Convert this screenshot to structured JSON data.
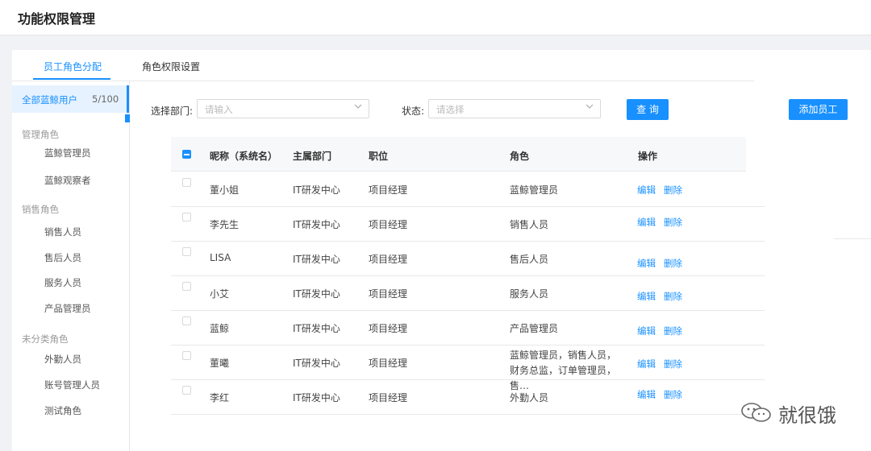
{
  "page": {
    "title": "功能权限管理"
  },
  "tabs": [
    {
      "label": "员工角色分配",
      "active": true
    },
    {
      "label": "角色权限设置",
      "active": false
    }
  ],
  "sidebar": {
    "all_users_label": "全部蓝鲸用户",
    "all_users_count": "5/100",
    "groups": [
      {
        "title": "管理角色",
        "items": [
          "蓝鲸管理员",
          "蓝鲸观察者"
        ]
      },
      {
        "title": "销售角色",
        "items": [
          "销售人员",
          "售后人员",
          "服务人员",
          "产品管理员"
        ]
      },
      {
        "title": "未分类角色",
        "items": [
          "外勤人员",
          "账号管理人员",
          "测试角色"
        ]
      }
    ]
  },
  "filters": {
    "dept_label": "选择部门:",
    "dept_placeholder": "请输入",
    "status_label": "状态:",
    "status_placeholder": "请选择",
    "query_button": "查 询",
    "add_button": "添加员工"
  },
  "table": {
    "columns": [
      "昵称（系统名）",
      "主属部门",
      "职位",
      "角色",
      "操作"
    ],
    "rows": [
      {
        "name": "董小姐",
        "dept": "IT研发中心",
        "position": "项目经理",
        "role": "蓝鲸管理员"
      },
      {
        "name": "李先生",
        "dept": "IT研发中心",
        "position": "项目经理",
        "role": "销售人员"
      },
      {
        "name": "LISA",
        "dept": "IT研发中心",
        "position": "项目经理",
        "role": "售后人员"
      },
      {
        "name": "小艾",
        "dept": "IT研发中心",
        "position": "项目经理",
        "role": "服务人员"
      },
      {
        "name": "蓝鲸",
        "dept": "IT研发中心",
        "position": "项目经理",
        "role": "产品管理员"
      },
      {
        "name": "董曦",
        "dept": "IT研发中心",
        "position": "项目经理",
        "role": "蓝鲸管理员，销售人员，财务总监，订单管理员，售…"
      },
      {
        "name": "李红",
        "dept": "IT研发中心",
        "position": "项目经理",
        "role": "外勤人员"
      }
    ],
    "edit_label": "编辑",
    "delete_label": "删除"
  },
  "watermark": {
    "text": "就很饿"
  },
  "colors": {
    "accent": "#1890ff",
    "background": "#f0f2f5",
    "selected_bg": "#e6f2ff"
  }
}
